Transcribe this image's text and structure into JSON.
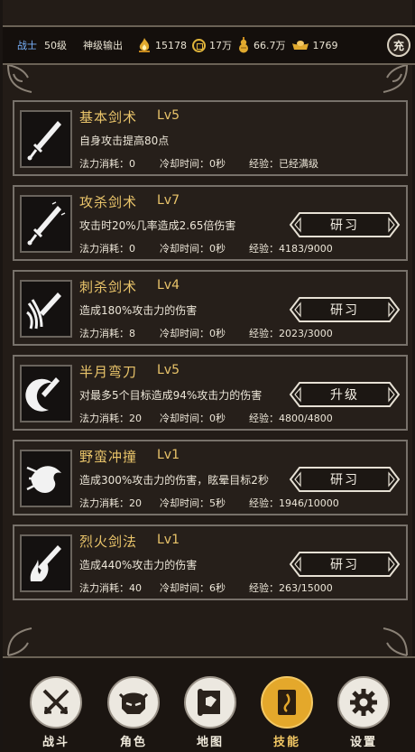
{
  "header": {
    "class_name": "战士",
    "level": "50级",
    "title": "神级输出",
    "resources": [
      {
        "icon": "flame-icon",
        "value": "15178"
      },
      {
        "icon": "copper-coin-icon",
        "value": "17万"
      },
      {
        "icon": "gourd-icon",
        "value": "66.7万"
      },
      {
        "icon": "gold-ingot-icon",
        "value": "1769"
      }
    ],
    "charge_label": "充"
  },
  "skills": [
    {
      "name": "基本剑术",
      "level": "Lv5",
      "desc": "自身攻击提高80点",
      "mana": "法力消耗：0",
      "cooldown": "冷却时间：0秒",
      "exp": "经验：已经满级",
      "button": ""
    },
    {
      "name": "攻杀剑术",
      "level": "Lv7",
      "desc": "攻击时20%几率造成2.65倍伤害",
      "mana": "法力消耗：0",
      "cooldown": "冷却时间：0秒",
      "exp": "经验：4183/9000",
      "button": "研习"
    },
    {
      "name": "刺杀剑术",
      "level": "Lv4",
      "desc": "造成180%攻击力的伤害",
      "mana": "法力消耗：8",
      "cooldown": "冷却时间：0秒",
      "exp": "经验：2023/3000",
      "button": "研习"
    },
    {
      "name": "半月弯刀",
      "level": "Lv5",
      "desc": "对最多5个目标造成94%攻击力的伤害",
      "mana": "法力消耗：20",
      "cooldown": "冷却时间：0秒",
      "exp": "经验：4800/4800",
      "button": "升级"
    },
    {
      "name": "野蛮冲撞",
      "level": "Lv1",
      "desc": "造成300%攻击力的伤害，眩晕目标2秒",
      "mana": "法力消耗：20",
      "cooldown": "冷却时间：5秒",
      "exp": "经验：1946/10000",
      "button": "研习"
    },
    {
      "name": "烈火剑法",
      "level": "Lv1",
      "desc": "造成440%攻击力的伤害",
      "mana": "法力消耗：40",
      "cooldown": "冷却时间：6秒",
      "exp": "经验：263/15000",
      "button": "研习"
    }
  ],
  "nav": [
    {
      "label": "战斗",
      "icon": "crossed-swords-icon"
    },
    {
      "label": "角色",
      "icon": "helmet-icon"
    },
    {
      "label": "地图",
      "icon": "map-scroll-icon"
    },
    {
      "label": "技能",
      "icon": "skill-book-icon",
      "active": true
    },
    {
      "label": "设置",
      "icon": "gear-icon"
    }
  ],
  "colors": {
    "background": "#231c17",
    "accent_gold": "#e9c46a",
    "class_blue": "#7ab4ff",
    "active_tab": "#e4a82b"
  }
}
